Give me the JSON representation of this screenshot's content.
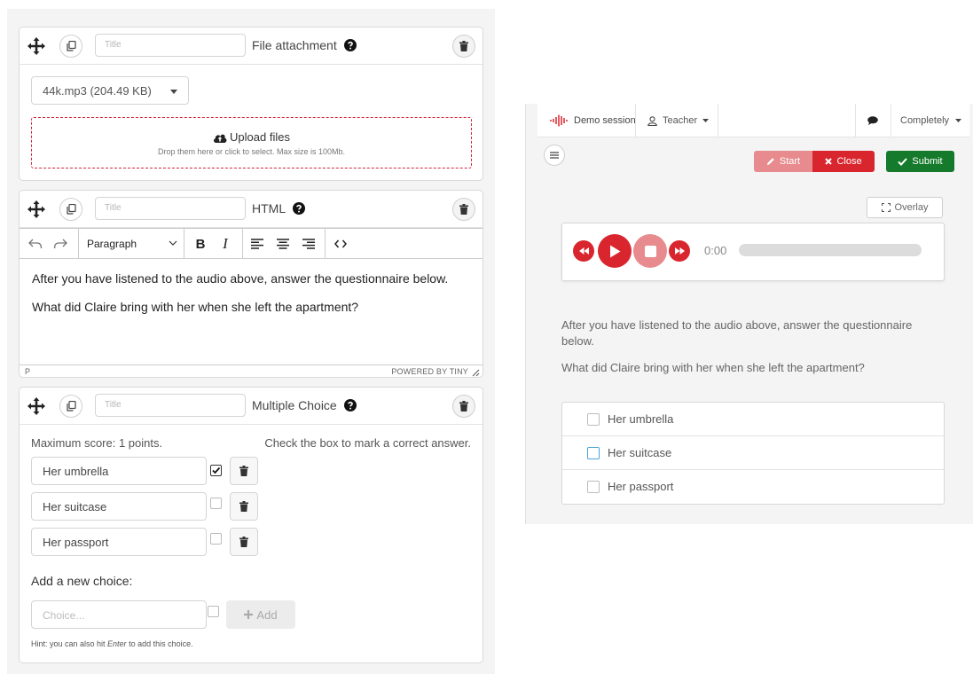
{
  "editor": {
    "title_placeholder": "Title",
    "file_card": {
      "type_label": "File attachment",
      "selected_file": "44k.mp3 (204.49 KB)",
      "upload_title": "Upload files",
      "upload_hint": "Drop them here or click to select. Max size is 100Mb."
    },
    "html_card": {
      "type_label": "HTML",
      "block_format": "Paragraph",
      "paragraphs": [
        "After you have listened to the audio above, answer the questionnaire below.",
        "What did Claire bring with her when she left the apartment?"
      ],
      "status_path": "P",
      "powered_by": "POWERED BY TINY"
    },
    "mc_card": {
      "type_label": "Multiple Choice",
      "max_score": "Maximum score: 1 points.",
      "check_hint": "Check the box to mark a correct answer.",
      "choices": [
        {
          "label": "Her umbrella",
          "correct": true
        },
        {
          "label": "Her suitcase",
          "correct": false
        },
        {
          "label": "Her passport",
          "correct": false
        }
      ],
      "add_label": "Add a new choice:",
      "new_choice_placeholder": "Choice...",
      "add_button": "Add",
      "hint_prefix": "Hint: you can also hit ",
      "hint_key": "Enter",
      "hint_suffix": " to add this choice."
    }
  },
  "preview": {
    "session": "Demo session",
    "role": "Teacher",
    "mode": "Completely",
    "start": "Start",
    "close": "Close",
    "submit": "Submit",
    "overlay": "Overlay",
    "time": "0:00",
    "text_1": "After you have listened to the audio above, answer the questionnaire below.",
    "text_2": "What did Claire bring with her when she left the apartment?",
    "answers": [
      "Her umbrella",
      "Her suitcase",
      "Her passport"
    ]
  },
  "colors": {
    "red": "#d9262e",
    "green": "#157a2b",
    "start_pink": "#e88b8e"
  }
}
